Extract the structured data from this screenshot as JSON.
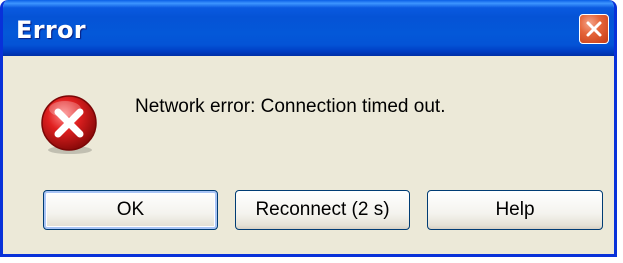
{
  "window": {
    "title": "Error"
  },
  "dialog": {
    "message": "Network error: Connection timed out.",
    "icon": "error-icon"
  },
  "buttons": {
    "ok_label": "OK",
    "reconnect_label": "Reconnect (2 s)",
    "help_label": "Help"
  },
  "colors": {
    "titlebar_blue": "#0453d6",
    "window_border": "#0831d9",
    "dialog_background": "#ece9d8",
    "close_button_red": "#e5653a",
    "error_icon_red": "#d11a1a"
  }
}
